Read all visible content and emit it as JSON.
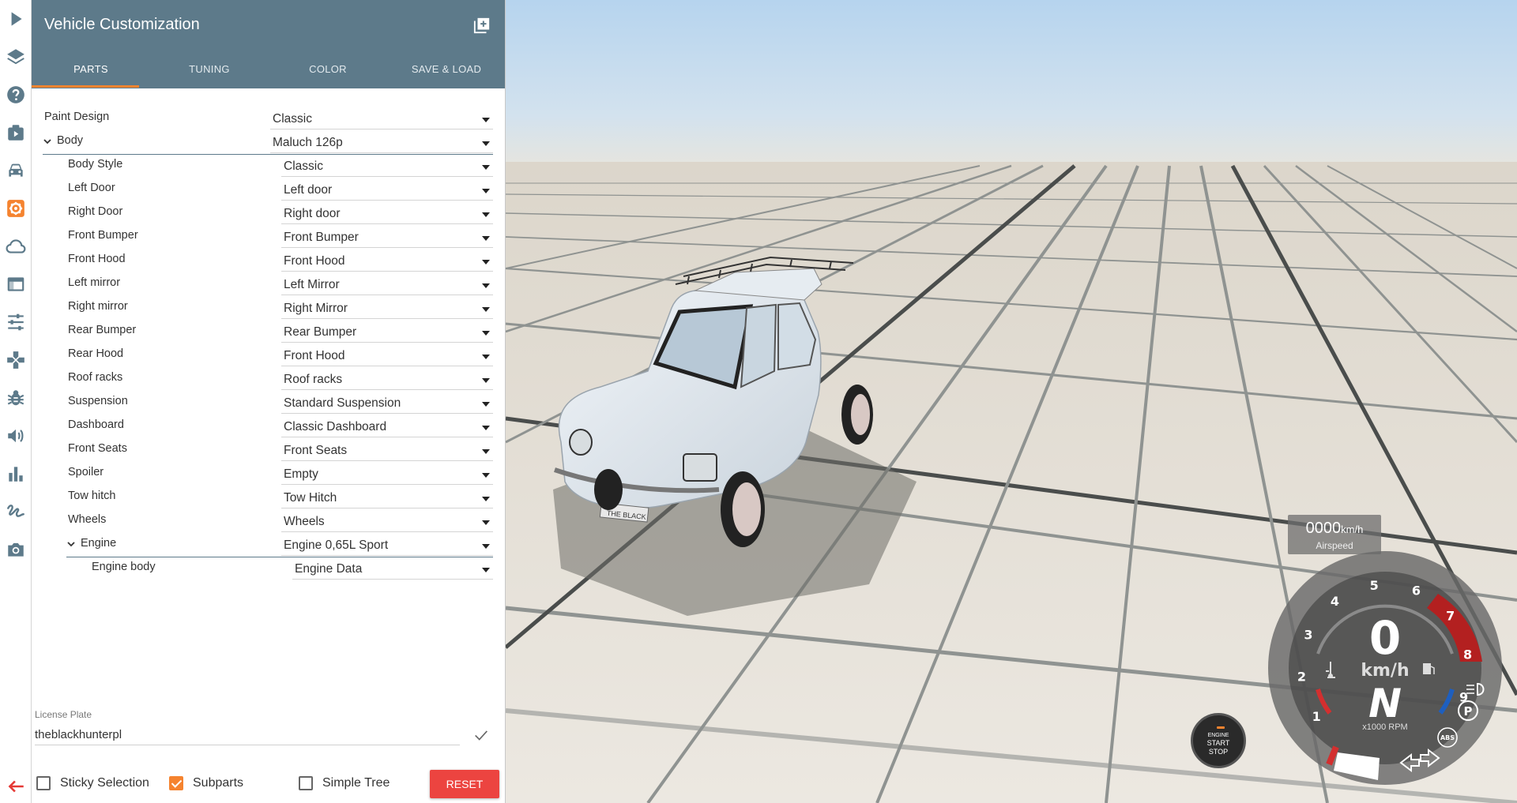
{
  "iconbar": {
    "items": [
      {
        "name": "play-icon",
        "active": false
      },
      {
        "name": "layers-icon",
        "active": false
      },
      {
        "name": "help-icon",
        "active": false
      },
      {
        "name": "scenario-icon",
        "active": false
      },
      {
        "name": "car-icon",
        "active": false
      },
      {
        "name": "vehicle-config-icon",
        "active": true
      },
      {
        "name": "cloud-icon",
        "active": false
      },
      {
        "name": "app-window-icon",
        "active": false
      },
      {
        "name": "tune-sliders-icon",
        "active": false
      },
      {
        "name": "gamepad-icon",
        "active": false
      },
      {
        "name": "bug-icon",
        "active": false
      },
      {
        "name": "volume-icon",
        "active": false
      },
      {
        "name": "bar-chart-icon",
        "active": false
      },
      {
        "name": "gesture-icon",
        "active": false
      },
      {
        "name": "camera-icon",
        "active": false
      },
      {
        "name": "back-arrow-icon",
        "active": false
      }
    ],
    "accent": "#f5832f"
  },
  "panel": {
    "title": "Vehicle Customization",
    "header_color": "#5d7a8a",
    "tabs": [
      {
        "label": "PARTS",
        "active": true
      },
      {
        "label": "TUNING",
        "active": false
      },
      {
        "label": "COLOR",
        "active": false
      },
      {
        "label": "SAVE & LOAD",
        "active": false
      }
    ],
    "parts": [
      {
        "label": "Paint Design",
        "value": "Classic",
        "level": 0,
        "expandable": false
      },
      {
        "label": "Body",
        "value": "Maluch 126p",
        "level": 0,
        "expandable": true
      },
      {
        "label": "Body Style",
        "value": "Classic",
        "level": 1,
        "expandable": false
      },
      {
        "label": "Left Door",
        "value": "Left door",
        "level": 1,
        "expandable": false
      },
      {
        "label": "Right Door",
        "value": "Right door",
        "level": 1,
        "expandable": false
      },
      {
        "label": "Front Bumper",
        "value": "Front Bumper",
        "level": 1,
        "expandable": false
      },
      {
        "label": "Front Hood",
        "value": "Front Hood",
        "level": 1,
        "expandable": false
      },
      {
        "label": "Left mirror",
        "value": "Left Mirror",
        "level": 1,
        "expandable": false
      },
      {
        "label": "Right mirror",
        "value": "Right Mirror",
        "level": 1,
        "expandable": false
      },
      {
        "label": "Rear Bumper",
        "value": "Rear Bumper",
        "level": 1,
        "expandable": false
      },
      {
        "label": "Rear Hood",
        "value": "Front Hood",
        "level": 1,
        "expandable": false
      },
      {
        "label": "Roof racks",
        "value": "Roof racks",
        "level": 1,
        "expandable": false
      },
      {
        "label": "Suspension",
        "value": "Standard Suspension",
        "level": 1,
        "expandable": false
      },
      {
        "label": "Dashboard",
        "value": "Classic Dashboard",
        "level": 1,
        "expandable": false
      },
      {
        "label": "Front Seats",
        "value": "Front Seats",
        "level": 1,
        "expandable": false
      },
      {
        "label": "Spoiler",
        "value": "Empty",
        "level": 1,
        "expandable": false
      },
      {
        "label": "Tow hitch",
        "value": "Tow Hitch",
        "level": 1,
        "expandable": false
      },
      {
        "label": "Wheels",
        "value": "Wheels",
        "level": 1,
        "expandable": false
      },
      {
        "label": "Engine",
        "value": "Engine 0,65L Sport",
        "level": 1,
        "expandable": true
      },
      {
        "label": "Engine body",
        "value": "Engine Data",
        "level": 2,
        "expandable": false
      }
    ],
    "license_plate": {
      "label": "License Plate",
      "value": "theblackhunterpl"
    },
    "options": {
      "sticky_selection": {
        "label": "Sticky Selection",
        "checked": false
      },
      "subparts": {
        "label": "Subparts",
        "checked": true
      },
      "simple_tree": {
        "label": "Simple Tree",
        "checked": false
      }
    },
    "reset_label": "RESET",
    "reset_color": "#ec4440"
  },
  "hud": {
    "airspeed": {
      "value": "0000",
      "unit": "km/h",
      "label": "Airspeed"
    },
    "engine_button": {
      "line1": "ENGINE",
      "line2": "START",
      "line3": "STOP"
    },
    "gauge": {
      "speed": "0",
      "speed_unit": "km/h",
      "gear": "N",
      "rpm_label": "x1000 RPM",
      "rpm_ticks": [
        "1",
        "2",
        "3",
        "4",
        "5",
        "6",
        "7",
        "8",
        "9"
      ],
      "indicators": [
        "headlight-icon",
        "parking-brake-icon",
        "abs-icon",
        "left-turn-signal-icon",
        "right-turn-signal-icon",
        "temperature-icon",
        "fuel-icon"
      ],
      "abs_label": "ABS",
      "parking_label": "P",
      "redline_color": "#b32020"
    },
    "vehicle_plate_text": "THE BLACK"
  }
}
